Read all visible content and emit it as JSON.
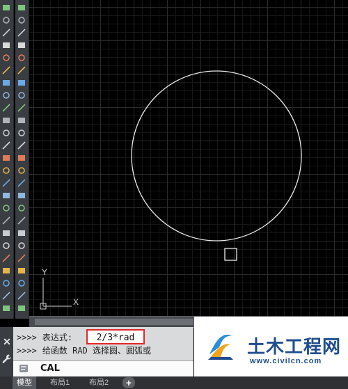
{
  "left_toolbar_1": {
    "icons": [
      "polyline-icon",
      "revcloud-icon",
      "ellipse-icon",
      "ellipse-arc-icon",
      "block-insert-icon",
      "block-create-icon",
      "line-icon",
      "point-icon",
      "hatch-icon",
      "gradient-icon",
      "region-icon",
      "table-icon",
      "text-icon",
      "multiline-text-icon",
      "layer-icon",
      "layer-state-icon",
      "copy-icon",
      "mirror-icon",
      "offset-icon",
      "array-icon",
      "move-icon",
      "rotate-icon",
      "scale-icon",
      "stretch-icon",
      "properties-icon"
    ]
  },
  "left_toolbar_2": {
    "icons": [
      "new-file-icon",
      "xline-icon",
      "construction-line-icon",
      "rectangle-icon",
      "polygon-icon",
      "arc-icon",
      "circle-icon",
      "spline-icon",
      "solid-icon",
      "box-icon",
      "snap-endpoint-icon",
      "snap-midpoint-icon",
      "snap-intersection-icon",
      "snap-center-icon",
      "snap-quadrant-icon",
      "snap-tangent-icon",
      "snap-perpendicular-icon",
      "snap-parallel-icon",
      "snap-node-icon",
      "snap-insert-icon",
      "snap-nearest-icon",
      "osnap-settings-icon",
      "undo-icon",
      "redo-icon",
      "explode-icon"
    ]
  },
  "canvas": {
    "ucs": {
      "x_label": "X",
      "y_label": "Y"
    },
    "circle_color": "#e8e8e8",
    "cursor_box_color": "#e8e8e8"
  },
  "command_line": {
    "history": [
      {
        "prompt": ">>>>",
        "text": "表达式:"
      },
      {
        "prompt": ">>>>",
        "text": "给函数 RAD 选择圆、圆弧或"
      }
    ],
    "highlighted_value": "2/3*rad",
    "highlight_color": "#e3282a",
    "input_value": "CAL"
  },
  "layout_tabs": [
    {
      "label": "模型",
      "active": true
    },
    {
      "label": "布局1",
      "active": false
    },
    {
      "label": "布局2",
      "active": false
    }
  ],
  "add_tab_label": "+",
  "watermark": {
    "name": "土木工程网",
    "url": "www.civilcn.com",
    "brand_color": "#1f4d8e"
  }
}
